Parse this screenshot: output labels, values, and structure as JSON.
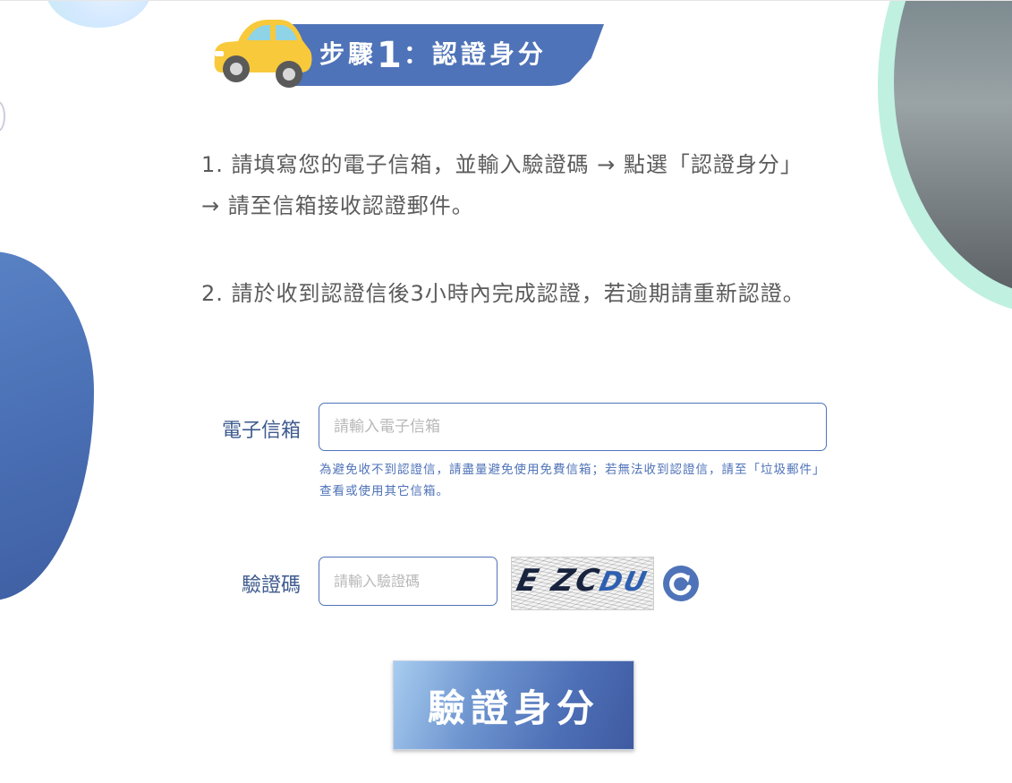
{
  "step_banner": {
    "prefix": "步驟",
    "number": "1",
    "suffix": "：認證身分"
  },
  "instructions": {
    "step1": "1. 請填寫您的電子信箱，並輸入驗證碼 → 點選「認證身分」→ 請至信箱接收認證郵件。",
    "step2": "2. 請於收到認證信後3小時內完成認證，若逾期請重新認證。"
  },
  "form": {
    "email_label": "電子信箱",
    "email_placeholder": "請輸入電子信箱",
    "email_value": "",
    "email_hint": "為避免收不到認證信，請盡量避免使用免費信箱；若無法收到認證信，請至「垃圾郵件」查看或使用其它信箱。",
    "captcha_label": "驗證碼",
    "captcha_placeholder": "請輸入驗證碼",
    "captcha_value": "",
    "captcha_text_dark": "E ZC",
    "captcha_text_blue": "DU",
    "refresh_icon": "refresh-icon",
    "submit_label": "驗證身分"
  },
  "colors": {
    "primary": "#4f73b8",
    "text": "#5b5b5b",
    "mint": "#bff0e0",
    "taxi_yellow": "#f3b21d"
  }
}
